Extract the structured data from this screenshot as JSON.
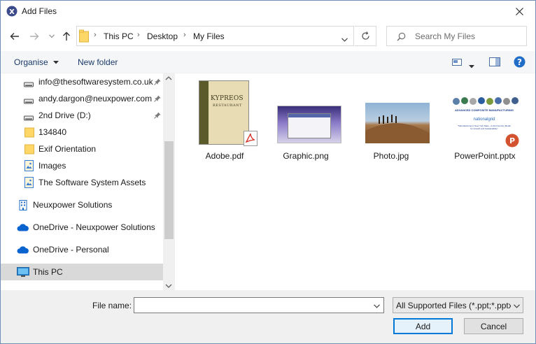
{
  "window": {
    "title": "Add Files"
  },
  "address": {
    "crumbs": [
      "This PC",
      "Desktop",
      "My Files"
    ],
    "separator": "›",
    "search_placeholder": "Search My Files"
  },
  "toolbar": {
    "organise_label": "Organise",
    "new_folder_label": "New folder"
  },
  "nav": {
    "items": [
      {
        "label": "info@thesoftwaresystem.co.uk",
        "icon": "drive-icon",
        "pinned": true
      },
      {
        "label": "andy.dargon@neuxpower.com",
        "icon": "drive-icon",
        "pinned": true
      },
      {
        "label": "2nd Drive (D:)",
        "icon": "drive-icon",
        "pinned": true
      },
      {
        "label": "134840",
        "icon": "folder-icon",
        "pinned": false
      },
      {
        "label": "Exif Orientation",
        "icon": "folder-icon",
        "pinned": false
      },
      {
        "label": "Images",
        "icon": "image-folder-icon",
        "pinned": false
      },
      {
        "label": "The Software System Assets",
        "icon": "image-folder-icon",
        "pinned": false
      },
      {
        "label": "Neuxpower Solutions",
        "icon": "building-icon",
        "pinned": false
      },
      {
        "label": "OneDrive - Neuxpower Solutions",
        "icon": "cloud-icon",
        "pinned": false
      },
      {
        "label": "OneDrive - Personal",
        "icon": "cloud-icon",
        "pinned": false
      },
      {
        "label": "This PC",
        "icon": "computer-icon",
        "pinned": false,
        "selected": true
      }
    ]
  },
  "files": [
    {
      "name": "Adobe.pdf",
      "type": "pdf",
      "thumb_text": "KYPREOS",
      "thumb_sub": "RESTAURANT"
    },
    {
      "name": "Graphic.png",
      "type": "png"
    },
    {
      "name": "Photo.jpg",
      "type": "jpg"
    },
    {
      "name": "PowerPoint.pptx",
      "type": "pptx",
      "thumb_text": "ADVANCED COMPOSITE MANUFACTURING",
      "thumb_mid": "nationalgrid",
      "thumb_sub": "\"Manufacturing in New York State - A 21st Century Model for Growth and Sustainability\""
    }
  ],
  "footer": {
    "file_name_label": "File name:",
    "file_name_value": "",
    "filter_value": "All Supported Files (*.ppt;*.pptx",
    "add_label": "Add",
    "cancel_label": "Cancel"
  },
  "colors": {
    "accent": "#0078d7",
    "folder": "#ffd766",
    "selection": "#d9d9d9",
    "help": "#1f6dc7"
  }
}
